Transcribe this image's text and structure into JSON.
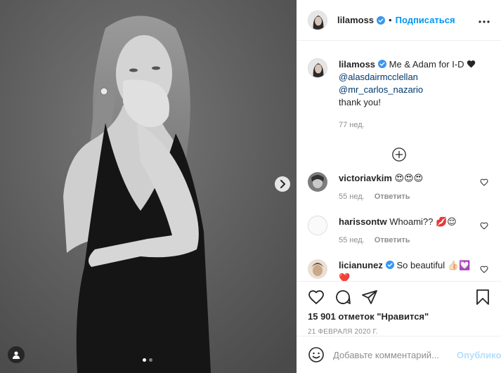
{
  "post": {
    "author": "lilamoss",
    "follow_label": "Подписаться",
    "separator": "•",
    "caption_text": " Me & Adam for I-D ",
    "caption_mention_1": "@alasdairmcclellan",
    "caption_mention_2": "@mr_carlos_nazario",
    "caption_tail": "thank you!",
    "caption_time": "77 нед.",
    "likes": "15 901 отметок \"Нравится\"",
    "date": "21 ФЕВРАЛЯ 2020 Г."
  },
  "comments": [
    {
      "user": "victoriavkim",
      "text": "😍😍😍",
      "time": "55 нед.",
      "reply": "Ответить"
    },
    {
      "user": "harissontw",
      "text": "Whoami?? 💋😌",
      "time": "55 нед.",
      "reply": "Ответить"
    },
    {
      "user": "licianunez",
      "text": "So beautiful 👍🏻💟❤️",
      "time": "",
      "reply": ""
    }
  ],
  "add_comment": {
    "placeholder": "Добавьте комментарий...",
    "publish_label": "Опубликовать"
  },
  "colors": {
    "accent": "#0095f6",
    "verified": "#3897f0",
    "publish_disabled": "#b2dffc",
    "muted": "#8e8e8e"
  },
  "icons": [
    "verified-icon",
    "more-icon",
    "add-circle-icon",
    "heart-icon",
    "comment-icon",
    "share-icon",
    "bookmark-icon",
    "smile-icon",
    "chevron-right-icon",
    "user-tag-icon"
  ]
}
